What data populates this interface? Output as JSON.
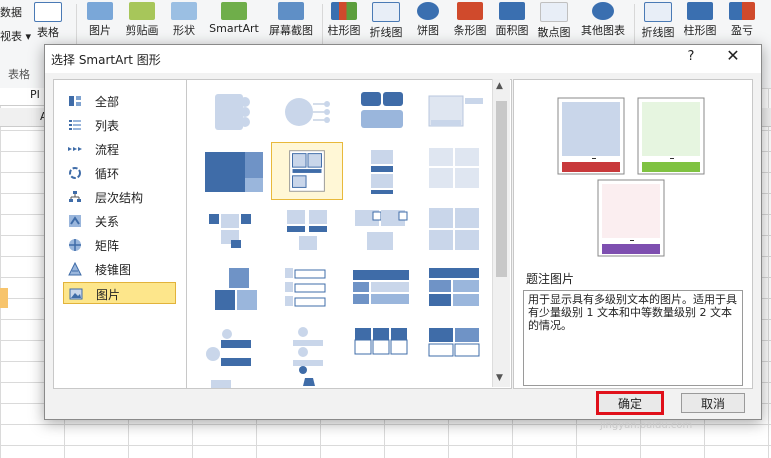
{
  "ribbon": {
    "left_partial_top": "数据",
    "left_partial_bottom": "视表 ▾",
    "table": "表格",
    "group_tables": "表格",
    "picture": "图片",
    "clipart": "剪贴画",
    "shapes": "形状",
    "smartart": "SmartArt",
    "screenshot": "屏幕截图",
    "column_chart": "柱形图",
    "line_chart": "折线图",
    "pie_chart": "饼图",
    "bar_chart": "条形图",
    "area_chart": "面积图",
    "scatter_chart": "散点图",
    "other_charts": "其他图表",
    "spark_line": "折线图",
    "spark_column": "柱形图",
    "spark_winloss": "盈亏"
  },
  "sheet": {
    "namebox": "PI",
    "col_letter": "A"
  },
  "dialog": {
    "title": "选择 SmartArt 图形",
    "help": "?",
    "close": "✕",
    "categories": [
      {
        "label": "全部",
        "icon": "all-icon"
      },
      {
        "label": "列表",
        "icon": "list-icon"
      },
      {
        "label": "流程",
        "icon": "process-icon"
      },
      {
        "label": "循环",
        "icon": "cycle-icon"
      },
      {
        "label": "层次结构",
        "icon": "hierarchy-icon"
      },
      {
        "label": "关系",
        "icon": "relationship-icon"
      },
      {
        "label": "矩阵",
        "icon": "matrix-icon"
      },
      {
        "label": "棱锥图",
        "icon": "pyramid-icon"
      },
      {
        "label": "图片",
        "icon": "picture-icon"
      }
    ],
    "selected_category": "图片",
    "preview_title": "题注图片",
    "preview_desc": "用于显示具有多级别文本的图片。适用于具有少量级别 1 文本和中等数量级别 2 文本的情况。",
    "ok": "确定",
    "cancel": "取消"
  },
  "watermark": "jingyan.baidu.com",
  "colors": {
    "accent_blue": "#3f6ca8",
    "light_blue": "#c9d6ea",
    "selection_yellow": "#fde68b",
    "highlight_red": "#e0101a",
    "green": "#7fc241",
    "purple": "#7e4fb0",
    "red_bar": "#c8393b"
  }
}
